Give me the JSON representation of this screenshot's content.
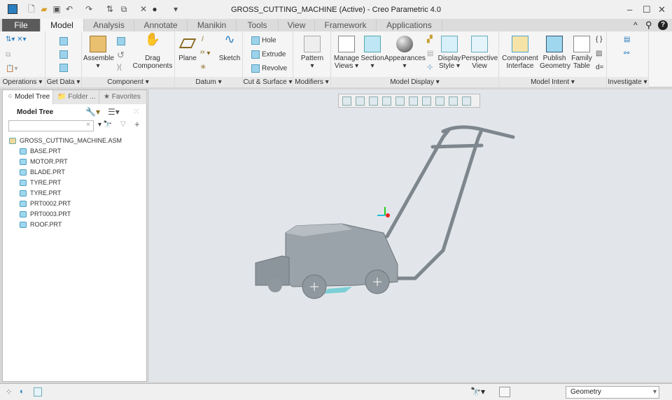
{
  "window": {
    "title": "GROSS_CUTTING_MACHINE (Active) - Creo Parametric 4.0",
    "minimize": "–",
    "maximize": "☐",
    "close": "✕"
  },
  "tabs": [
    "File",
    "Model",
    "Analysis",
    "Annotate",
    "Manikin",
    "Tools",
    "View",
    "Framework",
    "Applications"
  ],
  "ribbon": {
    "groups": [
      "Operations",
      "Get Data",
      "Component",
      "Datum",
      "Cut & Surface",
      "Modifiers",
      "Model Display",
      "Model Intent",
      "Investigate"
    ],
    "assemble": "Assemble",
    "drag_components": [
      "Drag",
      "Components"
    ],
    "plane": "Plane",
    "sketch": "Sketch",
    "hole": "Hole",
    "extrude": "Extrude",
    "revolve": "Revolve",
    "pattern": "Pattern",
    "manage_views": [
      "Manage",
      "Views ▾"
    ],
    "section": "Section",
    "appearances": "Appearances",
    "display_style": [
      "Display",
      "Style ▾"
    ],
    "perspective_view": [
      "Perspective",
      "View"
    ],
    "component_interface": [
      "Component",
      "Interface"
    ],
    "publish_geometry": [
      "Publish",
      "Geometry"
    ],
    "family_table": [
      "Family",
      "Table"
    ]
  },
  "left_panel": {
    "tabs": [
      "Model Tree",
      "Folder ...",
      "Favorites"
    ],
    "header": "Model Tree",
    "search_value": "",
    "root": "GROSS_CUTTING_MACHINE.ASM",
    "items": [
      "BASE.PRT",
      "MOTOR.PRT",
      "BLADE.PRT",
      "TYRE.PRT",
      "TYRE.PRT",
      "PRT0002.PRT",
      "PRT0003.PRT",
      "ROOF.PRT"
    ]
  },
  "status": {
    "filter": "Geometry"
  },
  "colors": {
    "file_tab": "#5b5b5b",
    "viewport": "#e2e6ea",
    "model": "#9aa3a9"
  }
}
